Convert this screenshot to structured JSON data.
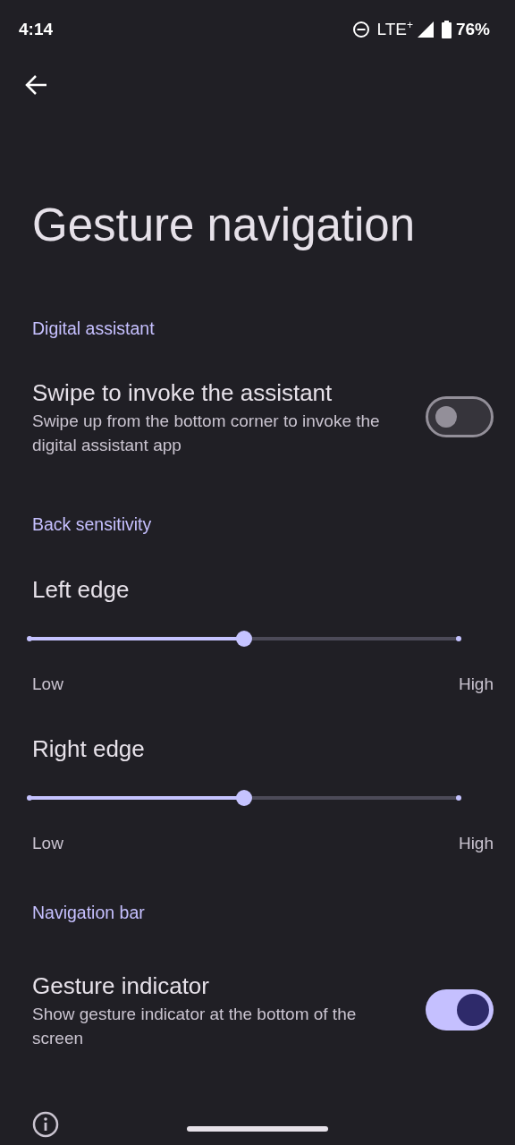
{
  "status_bar": {
    "time": "4:14",
    "network": "LTE$^{+}$",
    "battery": "76%"
  },
  "title": "Gesture navigation",
  "sections": [
    {
      "header": "Digital assistant",
      "items": [
        {
          "kind": "switch",
          "title": "Swipe to invoke the assistant",
          "summary": "Swipe up from the bottom corner to invoke the digital assistant app",
          "on": false
        }
      ]
    },
    {
      "header": "Back sensitivity",
      "items": [
        {
          "kind": "slider",
          "title": "Left edge",
          "level": 0.5,
          "min_label": "Low",
          "max_label": "High"
        },
        {
          "kind": "slider",
          "title": "Right edge",
          "level": 0.5,
          "min_label": "Low",
          "max_label": "High"
        }
      ]
    },
    {
      "header": "Navigation bar",
      "items": [
        {
          "kind": "switch",
          "title": "Gesture indicator",
          "summary": "Show gesture indicator at the bottom of the screen",
          "on": true
        }
      ]
    }
  ]
}
